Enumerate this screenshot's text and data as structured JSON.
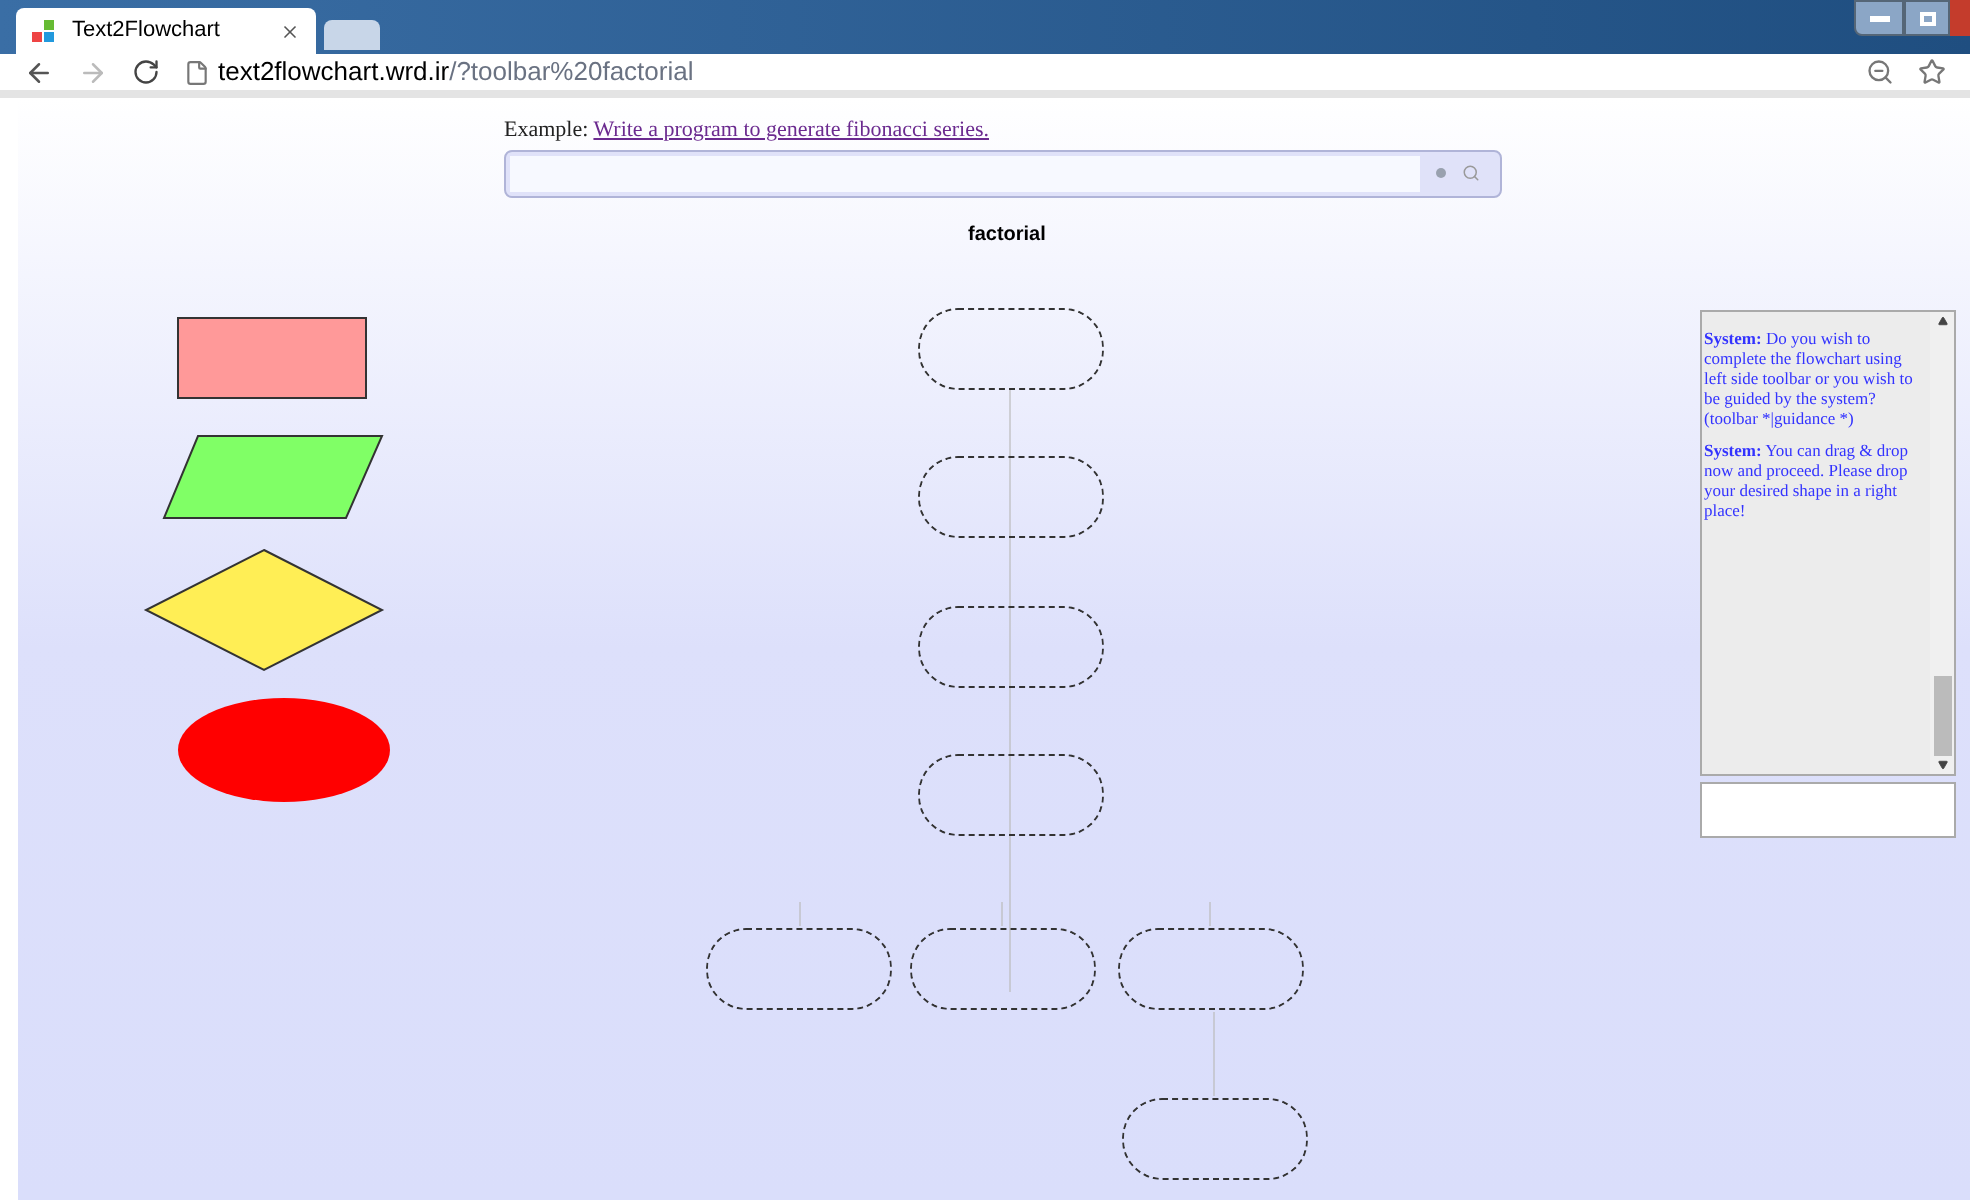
{
  "browser": {
    "tab_title": "Text2Flowchart",
    "url_host": "text2flowchart.wrd.ir",
    "url_path": "/?toolbar%20factorial"
  },
  "example": {
    "label": "Example:",
    "link": "Write a program to generate fibonacci series."
  },
  "chart_title": "factorial",
  "toolbar_shapes": [
    {
      "kind": "rectangle",
      "color": "#ff9999"
    },
    {
      "kind": "parallelogram",
      "color": "#80ff66"
    },
    {
      "kind": "diamond",
      "color": "#ffee55"
    },
    {
      "kind": "ellipse",
      "color": "#ff0000"
    }
  ],
  "flowchart_nodes": [
    {
      "kind": "placeholder"
    },
    {
      "kind": "placeholder"
    },
    {
      "kind": "placeholder"
    },
    {
      "kind": "placeholder"
    },
    {
      "kind": "placeholder"
    },
    {
      "kind": "placeholder"
    },
    {
      "kind": "placeholder"
    },
    {
      "kind": "placeholder"
    }
  ],
  "chat": {
    "messages": [
      {
        "text": "**System:** Do you wish to complete the flowchart using left side toolbar or you wish to be guided by the system? (toolbar *|guidance *)"
      },
      {
        "text": "**System:** You can drag & drop now and proceed. Please drop your desired shape in a right place!"
      }
    ]
  }
}
